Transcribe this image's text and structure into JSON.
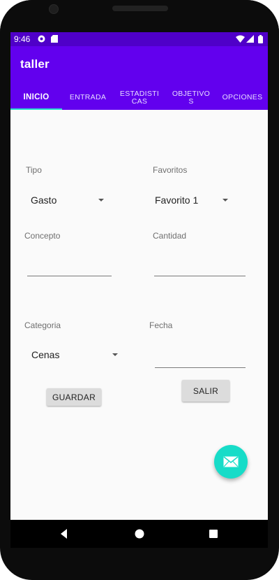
{
  "status_bar": {
    "time": "9:46",
    "icons": [
      "settings-notification-icon",
      "sd-card-icon",
      "wifi-icon",
      "signal-icon",
      "battery-icon"
    ]
  },
  "app_bar": {
    "title": "taller",
    "background": "#6200ee"
  },
  "tabs": [
    {
      "label": "INICIO",
      "active": true
    },
    {
      "label": "ENTRADA",
      "active": false
    },
    {
      "label": "ESTADISTI\nCAS",
      "active": false
    },
    {
      "label": "OBJETIVO\nS",
      "active": false
    },
    {
      "label": "OPCIONES",
      "active": false
    }
  ],
  "form": {
    "tipo": {
      "label": "Tipo",
      "value": "Gasto"
    },
    "favoritos": {
      "label": "Favoritos",
      "value": "Favorito 1"
    },
    "concepto": {
      "label": "Concepto",
      "value": ""
    },
    "cantidad": {
      "label": "Cantidad",
      "value": ""
    },
    "categoria": {
      "label": "Categoria",
      "value": "Cenas"
    },
    "fecha": {
      "label": "Fecha",
      "value": ""
    }
  },
  "buttons": {
    "guardar": "GUARDAR",
    "salir": "SALIR"
  },
  "fab": {
    "icon": "mail-icon",
    "color": "#17dcc8"
  },
  "nav_bar": {
    "back": "back-icon",
    "home": "home-icon",
    "recents": "recents-icon"
  }
}
